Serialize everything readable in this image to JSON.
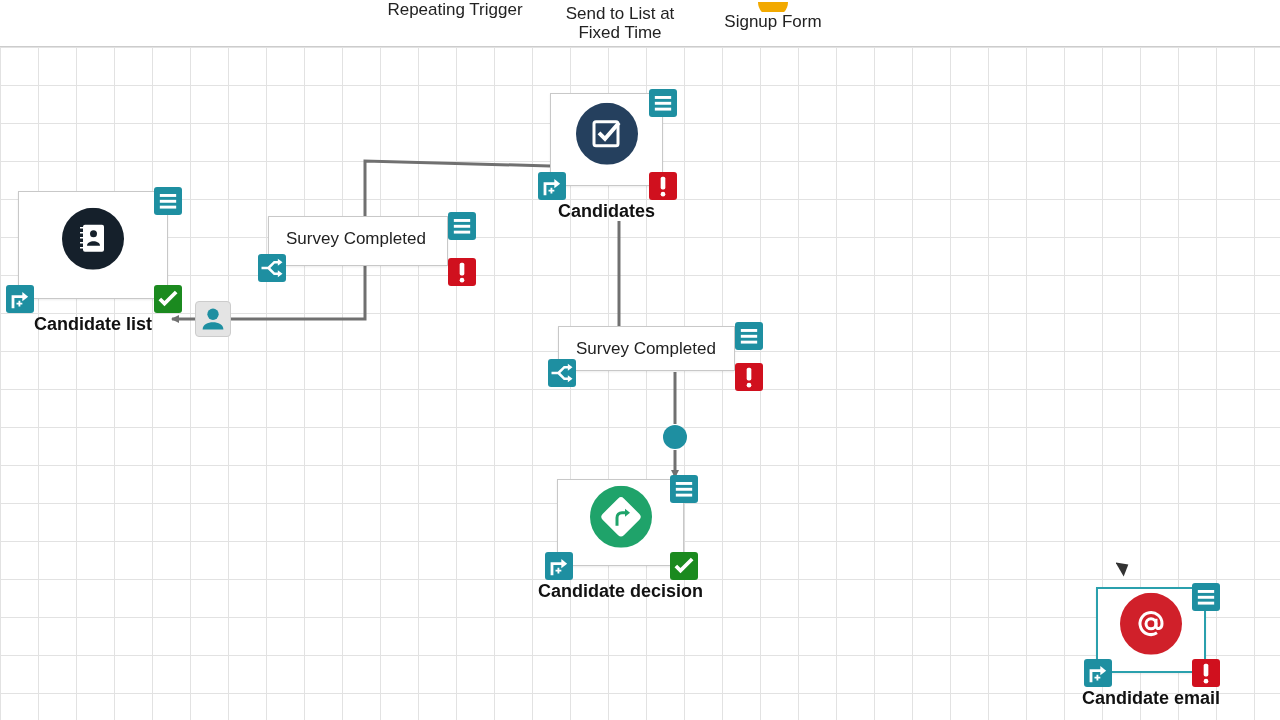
{
  "toolbar": {
    "items": [
      {
        "label": "Repeating Trigger",
        "kind": "plain"
      },
      {
        "label": "Send to List at Fixed Time",
        "kind": "plain"
      },
      {
        "label": "Signup Form",
        "kind": "form"
      }
    ]
  },
  "canvas": {
    "nodes": [
      {
        "kind": "list",
        "label": "Candidate list",
        "valid": true,
        "selected": false
      },
      {
        "kind": "trigger",
        "label": "Survey Completed",
        "valid": false,
        "selected": false
      },
      {
        "kind": "survey",
        "label": "Candidates",
        "valid": false,
        "selected": false
      },
      {
        "kind": "trigger",
        "label": "Survey Completed",
        "valid": false,
        "selected": false
      },
      {
        "kind": "decision",
        "label": "Candidate decision",
        "valid": true,
        "selected": false
      },
      {
        "kind": "email",
        "label": "Candidate email",
        "valid": false,
        "selected": true
      }
    ]
  }
}
